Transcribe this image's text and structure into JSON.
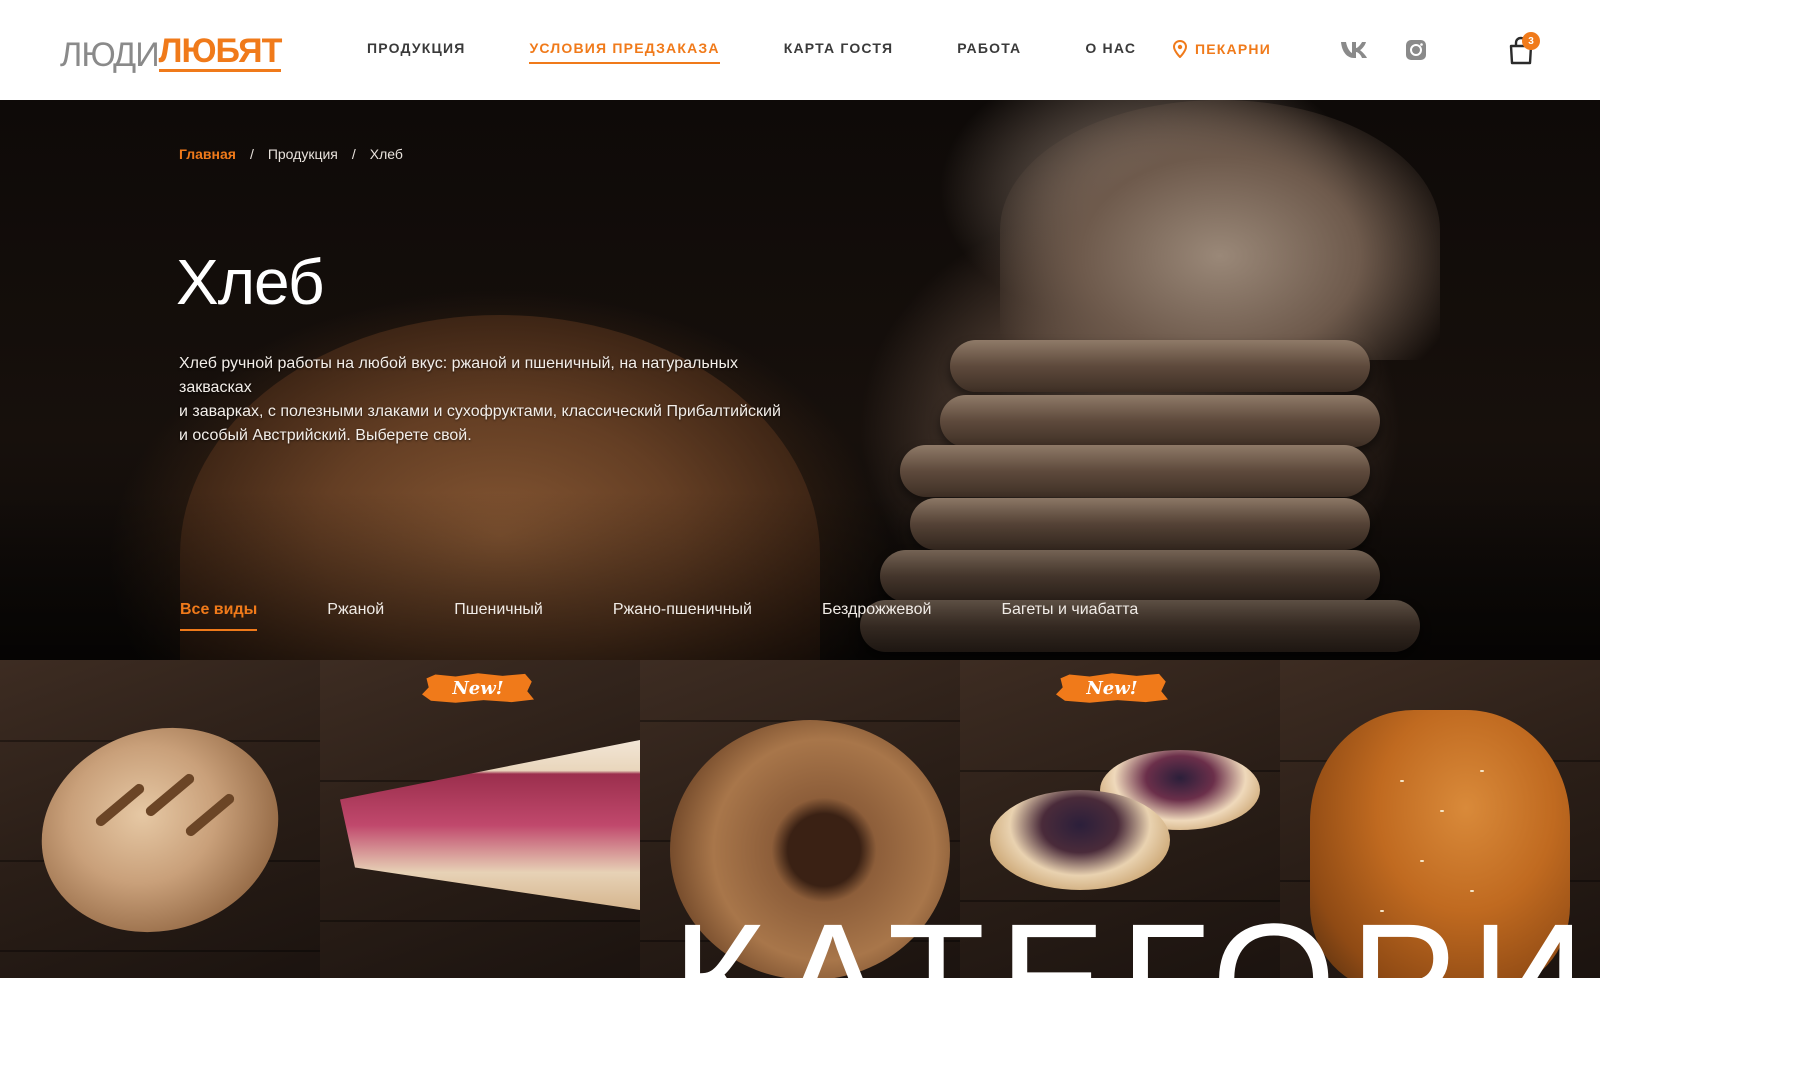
{
  "brand": {
    "logo_part1": "ЛЮДИ",
    "logo_part2": "ЛЮБЯТ",
    "accent_color": "#f07a1a"
  },
  "nav": {
    "items": [
      {
        "label": "ПРОДУКЦИЯ"
      },
      {
        "label": "УСЛОВИЯ ПРЕДЗАКАЗА",
        "active": true
      },
      {
        "label": "КАРТА ГОСТЯ"
      },
      {
        "label": "РАБОТА"
      },
      {
        "label": "О НАС"
      }
    ],
    "bakeries_label": "ПЕКАРНИ",
    "bakeries_icon": "map-pin-icon",
    "social": [
      "vk-icon",
      "instagram-icon"
    ],
    "cart_icon": "shopping-bag-icon",
    "cart_count": "3"
  },
  "breadcrumb": {
    "home": "Главная",
    "section": "Продукция",
    "current": "Хлеб",
    "separator": "/"
  },
  "hero": {
    "title": "Хлеб",
    "description_lines": [
      "Хлеб ручной работы на любой вкус: ржаной и пшеничный, на натуральных заквасках",
      "и заварках, с полезными злаками и сухофруктами,  классический Прибалтийский",
      "и особый Австрийский. Выберете свой."
    ]
  },
  "filters": {
    "items": [
      {
        "label": "Все виды",
        "active": true
      },
      {
        "label": "Ржаной"
      },
      {
        "label": "Пшеничный"
      },
      {
        "label": "Ржано-пшеничный"
      },
      {
        "label": "Бездрожжевой"
      },
      {
        "label": "Багеты и чиабатта"
      }
    ]
  },
  "tiles": [
    {
      "name": "bread-loaf",
      "badge": ""
    },
    {
      "name": "berry-pie",
      "badge": "New!"
    },
    {
      "name": "ring-bread",
      "badge": ""
    },
    {
      "name": "berry-tartlets",
      "badge": "New!"
    },
    {
      "name": "braided-bun",
      "badge": ""
    }
  ],
  "bottom_heading": "КАТЕГОРИ"
}
